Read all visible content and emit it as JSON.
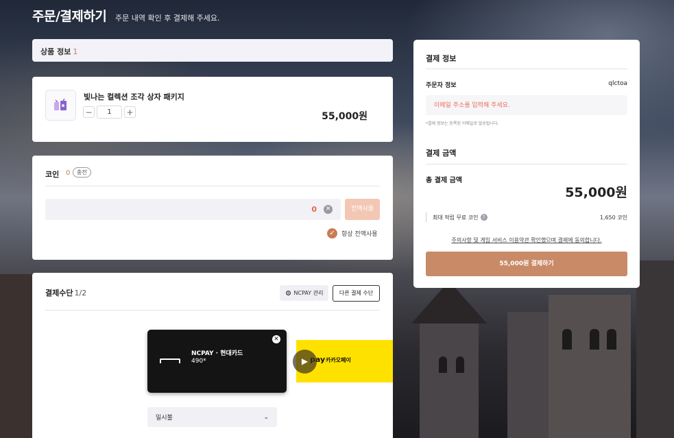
{
  "header": {
    "title": "주문/결제하기",
    "subtitle": "주문 내역 확인 후 결제해 주세요."
  },
  "product_section": {
    "label": "상품 정보",
    "count": "1"
  },
  "product": {
    "name": "빛나는 컬렉션 조각 상자 패키지",
    "quantity": "1",
    "minus": "−",
    "plus": "+",
    "price": "55,000원",
    "icon": "gift-box-icon"
  },
  "coin": {
    "label": "코인",
    "count": "0",
    "charge_label": "충전",
    "input_value": "0",
    "clear_symbol": "✕",
    "use_all_label": "전액사용",
    "always_use_label": "항상 전액사용",
    "check_symbol": "✓"
  },
  "payment_method": {
    "label": "결제수단",
    "count": "1/2",
    "ncpay_manage_label": "NCPAY 관리",
    "other_method_label": "다른 결제 수단",
    "ncpay_card": {
      "name": "NCPAY · 현대카드",
      "number": "490*",
      "close_symbol": "✕"
    },
    "kakao": {
      "logo": "pay",
      "label": "카카오페이",
      "color": "#ffe100"
    },
    "arrow_symbol": "▶",
    "installment_label": "일시불",
    "installment_chevron": "⌄"
  },
  "summary": {
    "heading": "결제 정보",
    "buyer_label": "주문자 정보",
    "buyer_id": "qlctoa",
    "email_placeholder": "이메일 주소를 입력해 주세요.",
    "email_note": "*결제 정보는 등록된 이메일로 발송됩니다.",
    "amount_heading": "결제 금액",
    "total_label": "총 결제 금액",
    "total_value": "55,000원",
    "reward_label": "최대 적립 무료 코인",
    "info_symbol": "?",
    "reward_value": "1,650 코인",
    "agree_text": "주의사항 및 게임 서비스 이용약관 확인했으며 결제에 동의합니다.",
    "pay_button_label": "55,000원 결제하기"
  },
  "colors": {
    "accent": "#c97c55",
    "pay_button": "#c98a68",
    "use_all_button": "#f3c7b4",
    "warning_text": "#ef6b55"
  }
}
